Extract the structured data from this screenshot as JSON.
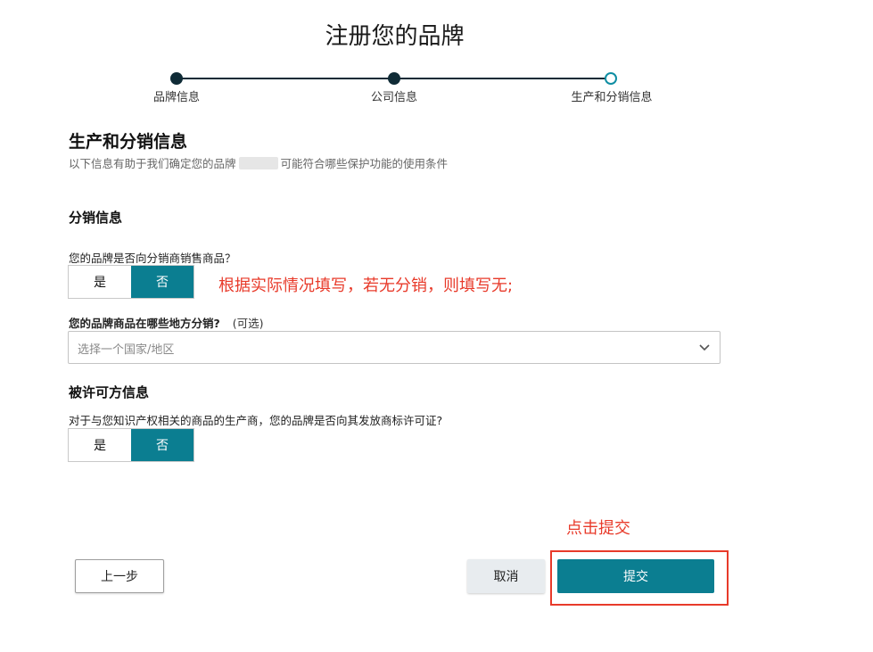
{
  "page_title": "注册您的品牌",
  "steps": [
    {
      "label": "品牌信息",
      "state": "done"
    },
    {
      "label": "公司信息",
      "state": "done"
    },
    {
      "label": "生产和分销信息",
      "state": "current"
    }
  ],
  "section": {
    "title": "生产和分销信息",
    "desc_prefix": "以下信息有助于我们确定您的品牌",
    "desc_suffix": "可能符合哪些保护功能的使用条件"
  },
  "distribution": {
    "heading": "分销信息",
    "question": "您的品牌是否向分销商销售商品？",
    "yes_label": "是",
    "no_label": "否",
    "selected": "no",
    "where_label": "您的品牌商品在哪些地方分销?",
    "where_optional": "(可选)",
    "select_placeholder": "选择一个国家/地区"
  },
  "licensor": {
    "heading": "被许可方信息",
    "question": "对于与您知识产权相关的商品的生产商，您的品牌是否向其发放商标许可证?",
    "yes_label": "是",
    "no_label": "否",
    "selected": "no"
  },
  "annotations": {
    "fill_note": "根据实际情况填写，若无分销，则填写无;",
    "click_note": "点击提交"
  },
  "buttons": {
    "prev": "上一步",
    "cancel": "取消",
    "submit": "提交"
  },
  "colors": {
    "accent": "#0b7e91",
    "stepper": "#0f2b36",
    "annotation": "#e83a2a"
  }
}
